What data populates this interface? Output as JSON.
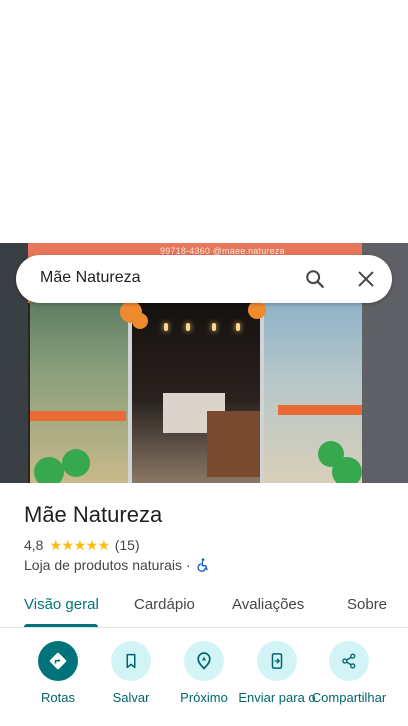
{
  "search": {
    "query": "Mãe Natureza"
  },
  "photo": {
    "sign_text": "99718-4360  @maee.natureza"
  },
  "place": {
    "name": "Mãe Natureza",
    "rating": "4,8",
    "stars": "★★★★★",
    "review_count": "(15)",
    "category": "Loja de produtos naturais",
    "separator": "·"
  },
  "tabs": [
    {
      "label": "Visão geral",
      "active": true
    },
    {
      "label": "Cardápio",
      "active": false
    },
    {
      "label": "Avaliações",
      "active": false
    },
    {
      "label": "Sobre",
      "active": false
    }
  ],
  "actions": [
    {
      "label": "Rotas",
      "icon": "directions-icon"
    },
    {
      "label": "Salvar",
      "icon": "bookmark-icon"
    },
    {
      "label": "Próximo",
      "icon": "nearby-icon"
    },
    {
      "label": "Enviar para o",
      "icon": "send-to-phone-icon"
    },
    {
      "label": "Compartilhar",
      "icon": "share-icon"
    }
  ],
  "colors": {
    "accent": "#00747a",
    "accent_light": "#d3f4f6",
    "star": "#fbbc04"
  }
}
